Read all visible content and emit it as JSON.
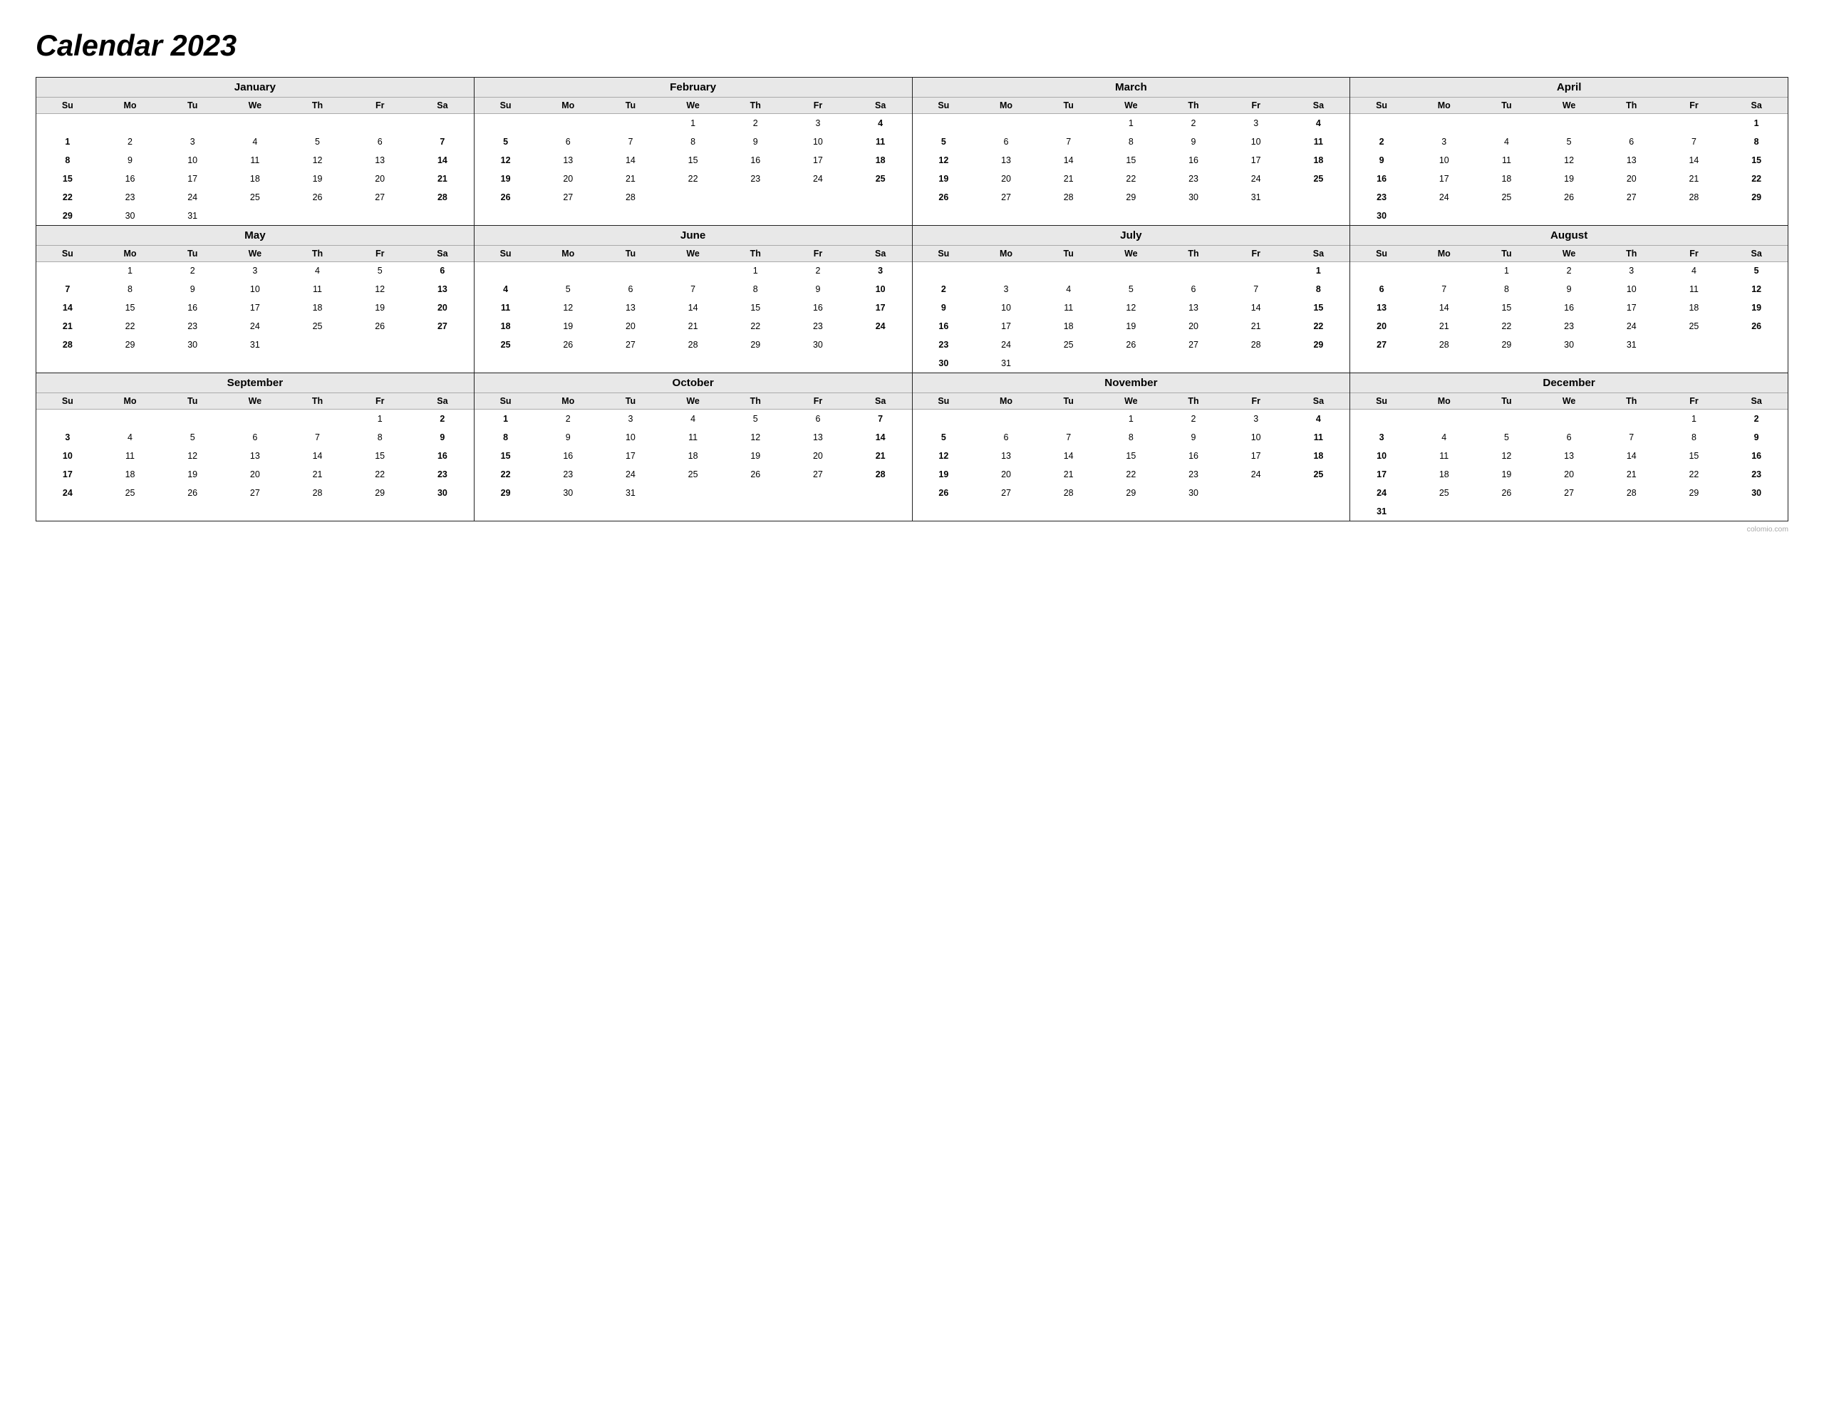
{
  "title": "Calendar 2023",
  "months": [
    {
      "name": "January",
      "days_header": [
        "Su",
        "Mo",
        "Tu",
        "We",
        "Th",
        "Fr",
        "Sa"
      ],
      "weeks": [
        [
          "",
          "",
          "",
          "",
          "",
          "",
          ""
        ],
        [
          "1",
          "2",
          "3",
          "4",
          "5",
          "6",
          "7"
        ],
        [
          "8",
          "9",
          "10",
          "11",
          "12",
          "13",
          "14"
        ],
        [
          "15",
          "16",
          "17",
          "18",
          "19",
          "20",
          "21"
        ],
        [
          "22",
          "23",
          "24",
          "25",
          "26",
          "27",
          "28"
        ],
        [
          "29",
          "30",
          "31",
          "",
          "",
          "",
          ""
        ]
      ],
      "bold_cols": [
        0,
        6
      ]
    },
    {
      "name": "February",
      "days_header": [
        "Su",
        "Mo",
        "Tu",
        "We",
        "Th",
        "Fr",
        "Sa"
      ],
      "weeks": [
        [
          "",
          "",
          "",
          "1",
          "2",
          "3",
          "4"
        ],
        [
          "5",
          "6",
          "7",
          "8",
          "9",
          "10",
          "11"
        ],
        [
          "12",
          "13",
          "14",
          "15",
          "16",
          "17",
          "18"
        ],
        [
          "19",
          "20",
          "21",
          "22",
          "23",
          "24",
          "25"
        ],
        [
          "26",
          "27",
          "28",
          "",
          "",
          "",
          ""
        ],
        [
          "",
          "",
          "",
          "",
          "",
          "",
          ""
        ]
      ],
      "bold_cols": [
        0,
        6
      ]
    },
    {
      "name": "March",
      "days_header": [
        "Su",
        "Mo",
        "Tu",
        "We",
        "Th",
        "Fr",
        "Sa"
      ],
      "weeks": [
        [
          "",
          "",
          "",
          "1",
          "2",
          "3",
          "4"
        ],
        [
          "5",
          "6",
          "7",
          "8",
          "9",
          "10",
          "11"
        ],
        [
          "12",
          "13",
          "14",
          "15",
          "16",
          "17",
          "18"
        ],
        [
          "19",
          "20",
          "21",
          "22",
          "23",
          "24",
          "25"
        ],
        [
          "26",
          "27",
          "28",
          "29",
          "30",
          "31",
          ""
        ],
        [
          "",
          "",
          "",
          "",
          "",
          "",
          ""
        ]
      ],
      "bold_cols": [
        0,
        6
      ]
    },
    {
      "name": "April",
      "days_header": [
        "Su",
        "Mo",
        "Tu",
        "We",
        "Th",
        "Fr",
        "Sa"
      ],
      "weeks": [
        [
          "",
          "",
          "",
          "",
          "",
          "",
          "1"
        ],
        [
          "2",
          "3",
          "4",
          "5",
          "6",
          "7",
          "8"
        ],
        [
          "9",
          "10",
          "11",
          "12",
          "13",
          "14",
          "15"
        ],
        [
          "16",
          "17",
          "18",
          "19",
          "20",
          "21",
          "22"
        ],
        [
          "23",
          "24",
          "25",
          "26",
          "27",
          "28",
          "29"
        ],
        [
          "30",
          "",
          "",
          "",
          "",
          "",
          ""
        ]
      ],
      "bold_cols": [
        0,
        6
      ]
    },
    {
      "name": "May",
      "days_header": [
        "Su",
        "Mo",
        "Tu",
        "We",
        "Th",
        "Fr",
        "Sa"
      ],
      "weeks": [
        [
          "",
          "1",
          "2",
          "3",
          "4",
          "5",
          "6"
        ],
        [
          "7",
          "8",
          "9",
          "10",
          "11",
          "12",
          "13"
        ],
        [
          "14",
          "15",
          "16",
          "17",
          "18",
          "19",
          "20"
        ],
        [
          "21",
          "22",
          "23",
          "24",
          "25",
          "26",
          "27"
        ],
        [
          "28",
          "29",
          "30",
          "31",
          "",
          "",
          ""
        ],
        [
          "",
          "",
          "",
          "",
          "",
          "",
          ""
        ]
      ],
      "bold_cols": [
        0,
        6
      ]
    },
    {
      "name": "June",
      "days_header": [
        "Su",
        "Mo",
        "Tu",
        "We",
        "Th",
        "Fr",
        "Sa"
      ],
      "weeks": [
        [
          "",
          "",
          "",
          "",
          "1",
          "2",
          "3"
        ],
        [
          "4",
          "5",
          "6",
          "7",
          "8",
          "9",
          "10"
        ],
        [
          "11",
          "12",
          "13",
          "14",
          "15",
          "16",
          "17"
        ],
        [
          "18",
          "19",
          "20",
          "21",
          "22",
          "23",
          "24"
        ],
        [
          "25",
          "26",
          "27",
          "28",
          "29",
          "30",
          ""
        ],
        [
          "",
          "",
          "",
          "",
          "",
          "",
          ""
        ]
      ],
      "bold_cols": [
        0,
        6
      ]
    },
    {
      "name": "July",
      "days_header": [
        "Su",
        "Mo",
        "Tu",
        "We",
        "Th",
        "Fr",
        "Sa"
      ],
      "weeks": [
        [
          "",
          "",
          "",
          "",
          "",
          "",
          "1"
        ],
        [
          "2",
          "3",
          "4",
          "5",
          "6",
          "7",
          "8"
        ],
        [
          "9",
          "10",
          "11",
          "12",
          "13",
          "14",
          "15"
        ],
        [
          "16",
          "17",
          "18",
          "19",
          "20",
          "21",
          "22"
        ],
        [
          "23",
          "24",
          "25",
          "26",
          "27",
          "28",
          "29"
        ],
        [
          "30",
          "31",
          "",
          "",
          "",
          "",
          ""
        ]
      ],
      "bold_cols": [
        0,
        6
      ]
    },
    {
      "name": "August",
      "days_header": [
        "Su",
        "Mo",
        "Tu",
        "We",
        "Th",
        "Fr",
        "Sa"
      ],
      "weeks": [
        [
          "",
          "",
          "1",
          "2",
          "3",
          "4",
          "5"
        ],
        [
          "6",
          "7",
          "8",
          "9",
          "10",
          "11",
          "12"
        ],
        [
          "13",
          "14",
          "15",
          "16",
          "17",
          "18",
          "19"
        ],
        [
          "20",
          "21",
          "22",
          "23",
          "24",
          "25",
          "26"
        ],
        [
          "27",
          "28",
          "29",
          "30",
          "31",
          "",
          ""
        ],
        [
          "",
          "",
          "",
          "",
          "",
          "",
          ""
        ]
      ],
      "bold_cols": [
        0,
        6
      ]
    },
    {
      "name": "September",
      "days_header": [
        "Su",
        "Mo",
        "Tu",
        "We",
        "Th",
        "Fr",
        "Sa"
      ],
      "weeks": [
        [
          "",
          "",
          "",
          "",
          "",
          "1",
          "2"
        ],
        [
          "3",
          "4",
          "5",
          "6",
          "7",
          "8",
          "9"
        ],
        [
          "10",
          "11",
          "12",
          "13",
          "14",
          "15",
          "16"
        ],
        [
          "17",
          "18",
          "19",
          "20",
          "21",
          "22",
          "23"
        ],
        [
          "24",
          "25",
          "26",
          "27",
          "28",
          "29",
          "30"
        ],
        [
          "",
          "",
          "",
          "",
          "",
          "",
          ""
        ]
      ],
      "bold_cols": [
        0,
        6
      ]
    },
    {
      "name": "October",
      "days_header": [
        "Su",
        "Mo",
        "Tu",
        "We",
        "Th",
        "Fr",
        "Sa"
      ],
      "weeks": [
        [
          "1",
          "2",
          "3",
          "4",
          "5",
          "6",
          "7"
        ],
        [
          "8",
          "9",
          "10",
          "11",
          "12",
          "13",
          "14"
        ],
        [
          "15",
          "16",
          "17",
          "18",
          "19",
          "20",
          "21"
        ],
        [
          "22",
          "23",
          "24",
          "25",
          "26",
          "27",
          "28"
        ],
        [
          "29",
          "30",
          "31",
          "",
          "",
          "",
          ""
        ],
        [
          "",
          "",
          "",
          "",
          "",
          "",
          ""
        ]
      ],
      "bold_cols": [
        0,
        6
      ]
    },
    {
      "name": "November",
      "days_header": [
        "Su",
        "Mo",
        "Tu",
        "We",
        "Th",
        "Fr",
        "Sa"
      ],
      "weeks": [
        [
          "",
          "",
          "",
          "1",
          "2",
          "3",
          "4"
        ],
        [
          "5",
          "6",
          "7",
          "8",
          "9",
          "10",
          "11"
        ],
        [
          "12",
          "13",
          "14",
          "15",
          "16",
          "17",
          "18"
        ],
        [
          "19",
          "20",
          "21",
          "22",
          "23",
          "24",
          "25"
        ],
        [
          "26",
          "27",
          "28",
          "29",
          "30",
          "",
          ""
        ],
        [
          "",
          "",
          "",
          "",
          "",
          "",
          ""
        ]
      ],
      "bold_cols": [
        0,
        6
      ]
    },
    {
      "name": "December",
      "days_header": [
        "Su",
        "Mo",
        "Tu",
        "We",
        "Th",
        "Fr",
        "Sa"
      ],
      "weeks": [
        [
          "",
          "",
          "",
          "",
          "",
          "1",
          "2"
        ],
        [
          "3",
          "4",
          "5",
          "6",
          "7",
          "8",
          "9"
        ],
        [
          "10",
          "11",
          "12",
          "13",
          "14",
          "15",
          "16"
        ],
        [
          "17",
          "18",
          "19",
          "20",
          "21",
          "22",
          "23"
        ],
        [
          "24",
          "25",
          "26",
          "27",
          "28",
          "29",
          "30"
        ],
        [
          "31",
          "",
          "",
          "",
          "",
          "",
          ""
        ]
      ],
      "bold_cols": [
        0,
        6
      ]
    }
  ],
  "watermark": "colomio.com"
}
